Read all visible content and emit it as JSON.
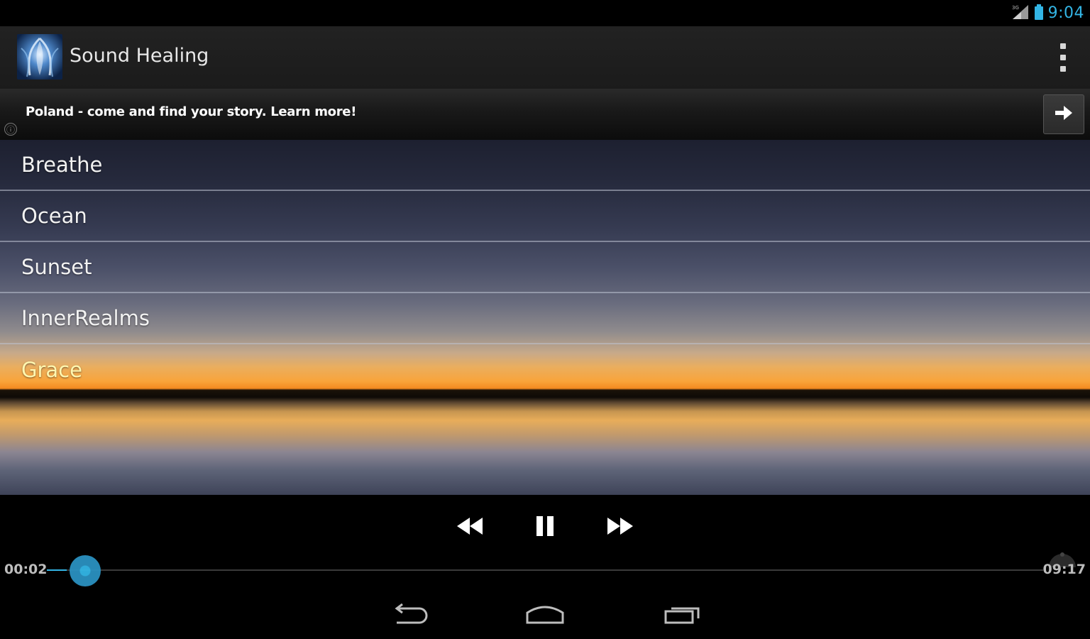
{
  "status_bar": {
    "clock": "9:04",
    "clock_color": "#33b5e5",
    "icons": [
      "signal-icon",
      "battery-icon"
    ]
  },
  "action_bar": {
    "title": "Sound Healing",
    "logo_icon": "app-logo-icon",
    "overflow_icon": "overflow-menu-icon"
  },
  "ad": {
    "text": "Poland - come and find your story. Learn more!",
    "info_icon_glyph": "ⓘ",
    "arrow_icon": "arrow-right-icon"
  },
  "tracks": [
    {
      "label": "Breathe"
    },
    {
      "label": "Ocean"
    },
    {
      "label": "Sunset"
    },
    {
      "label": "InnerRealms"
    },
    {
      "label": "Grace"
    }
  ],
  "player": {
    "current_time": "00:02",
    "total_time": "09:17",
    "progress": 0.02,
    "accent_color": "#33b5e5",
    "icons": [
      "rewind-icon",
      "pause-icon",
      "fast-forward-icon"
    ]
  },
  "nav_bar": {
    "icons": [
      "back-icon",
      "home-icon",
      "recent-apps-icon"
    ]
  }
}
